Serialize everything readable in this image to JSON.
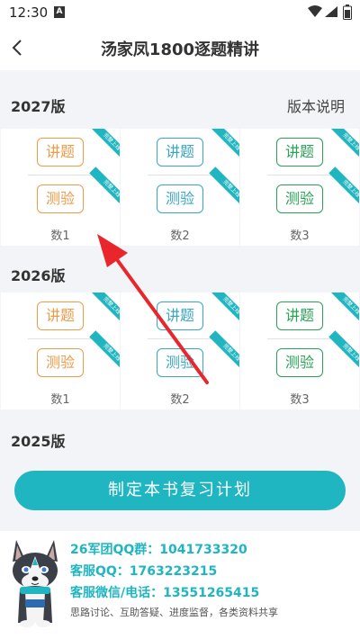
{
  "status_bar": {
    "time": "12:30",
    "a_icon": "A",
    "icons": [
      "wifi-icon",
      "signal-icon",
      "battery-icon"
    ]
  },
  "header": {
    "back_icon": "chevron-left-icon",
    "title": "汤家凤1800逐题精讲"
  },
  "sections": [
    {
      "label": "2027版",
      "right_link": "版本说明",
      "cards": [
        {
          "subject": "数1",
          "lecture": "讲题",
          "test": "测验",
          "badge": "完整上线",
          "color": "#f09a48"
        },
        {
          "subject": "数2",
          "lecture": "讲题",
          "test": "测验",
          "badge": "完整上线",
          "color": "#39a6c5"
        },
        {
          "subject": "数3",
          "lecture": "讲题",
          "test": "测验",
          "badge": "完整上线",
          "color": "#2aa255"
        }
      ]
    },
    {
      "label": "2026版",
      "cards": [
        {
          "subject": "数1",
          "lecture": "讲题",
          "test": "测验",
          "badge": "完整上线",
          "color": "#f09a48"
        },
        {
          "subject": "数2",
          "lecture": "讲题",
          "test": "测验",
          "badge": "完整上线",
          "color": "#39a6c5"
        },
        {
          "subject": "数3",
          "lecture": "讲题",
          "test": "测验",
          "badge": "完整上线",
          "color": "#2aa255"
        }
      ]
    },
    {
      "label": "2025版"
    }
  ],
  "plan_button": {
    "label": "制定本书复习计划"
  },
  "contact": {
    "qq_group": "26军团QQ群：1041733320",
    "service_qq": "客服QQ：1763223215",
    "service_wechat": "客服微信/电话：13551265415",
    "description": "思路讨论、互助答疑、进度监督，各类资料共享"
  },
  "colors": {
    "accent": "#1fb5c1",
    "orange": "#f09a48",
    "blue": "#39a6c5",
    "green": "#2aa255",
    "arrow": "#e8262b"
  }
}
